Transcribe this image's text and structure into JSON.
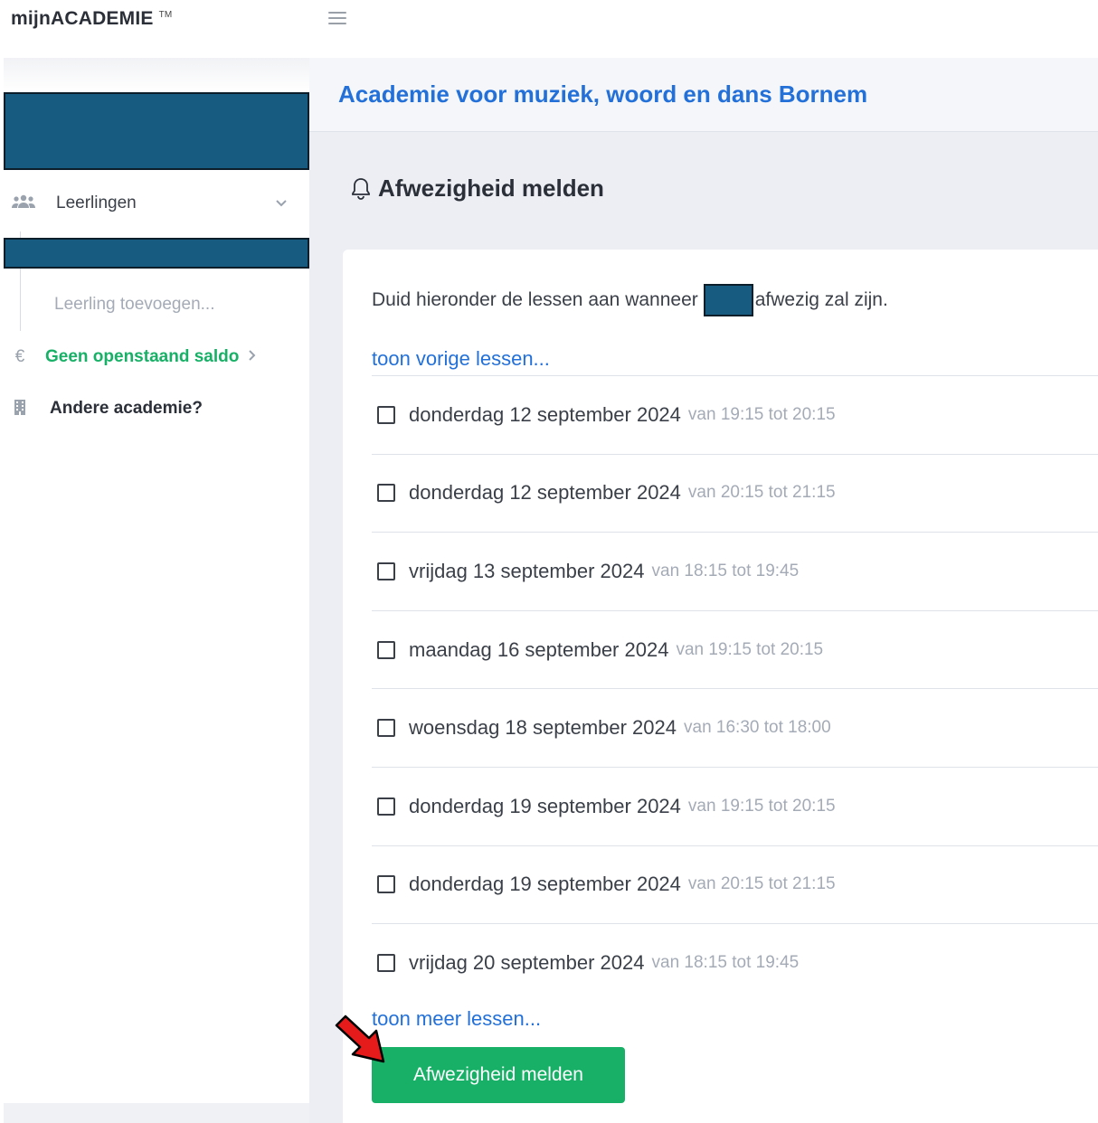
{
  "app": {
    "brand": "mijnACADEMIE",
    "trademark": "TM"
  },
  "sidebar": {
    "students_label": "Leerlingen",
    "add_student_label": "Leerling toevoegen...",
    "balance_label": "Geen openstaand saldo",
    "balance_icon": "€",
    "other_academy_label": "Andere academie?"
  },
  "header": {
    "academy_title": "Academie voor muziek, woord en dans Bornem"
  },
  "page": {
    "title": "Afwezigheid melden",
    "intro_before": "Duid hieronder de lessen aan wanneer",
    "intro_after": "afwezig zal zijn.",
    "show_previous": "toon vorige lessen...",
    "show_more": "toon meer lessen...",
    "submit_label": "Afwezigheid melden"
  },
  "lessons": [
    {
      "date": "donderdag 12 september 2024",
      "time": "van 19:15 tot 20:15"
    },
    {
      "date": "donderdag 12 september 2024",
      "time": "van 20:15 tot 21:15"
    },
    {
      "date": "vrijdag 13 september 2024",
      "time": "van 18:15 tot 19:45"
    },
    {
      "date": "maandag 16 september 2024",
      "time": "van 19:15 tot 20:15"
    },
    {
      "date": "woensdag 18 september 2024",
      "time": "van 16:30 tot 18:00"
    },
    {
      "date": "donderdag 19 september 2024",
      "time": "van 19:15 tot 20:15"
    },
    {
      "date": "donderdag 19 september 2024",
      "time": "van 20:15 tot 21:15"
    },
    {
      "date": "vrijdag 20 september 2024",
      "time": "van 18:15 tot 19:45"
    }
  ],
  "colors": {
    "accent_blue": "#2270d8",
    "success_green": "#17b066",
    "redaction": "#175b80"
  }
}
